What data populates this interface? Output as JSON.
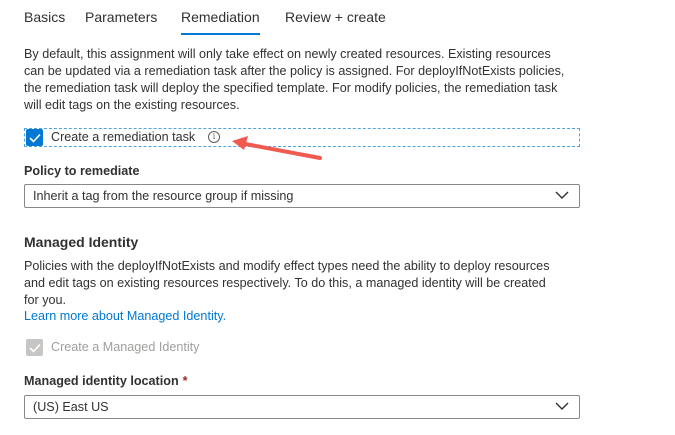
{
  "tabs": [
    {
      "label": "Basics"
    },
    {
      "label": "Parameters"
    },
    {
      "label": "Remediation"
    },
    {
      "label": "Review + create"
    }
  ],
  "active_tab": "Remediation",
  "remediation": {
    "description_lines": [
      "By default, this assignment will only take effect on newly created resources. Existing resources",
      "can be updated via a remediation task after the policy is assigned. For deployIfNotExists policies,",
      "the remediation task will deploy the specified template. For modify policies, the remediation task",
      "will edit tags on the existing resources."
    ],
    "create_task_label": "Create a remediation task",
    "create_task_checked": true,
    "policy_label": "Policy to remediate",
    "policy_value": "Inherit a tag from the resource group if missing"
  },
  "managed_identity": {
    "heading": "Managed Identity",
    "description_lines": [
      "Policies with the deployIfNotExists and modify effect types need the ability to deploy resources",
      "and edit tags on existing resources respectively. To do this, a managed identity will be created",
      "for you."
    ],
    "learn_more_link": "Learn more about Managed Identity.",
    "create_identity_label": "Create a Managed Identity",
    "create_identity_checked": true,
    "create_identity_disabled": true,
    "location_label": "Managed identity location",
    "location_required_mark": "*",
    "location_value": "(US) East US"
  },
  "colors": {
    "accent": "#0078d4",
    "annotation_arrow": "#f05a4f",
    "required": "#a4262c"
  }
}
